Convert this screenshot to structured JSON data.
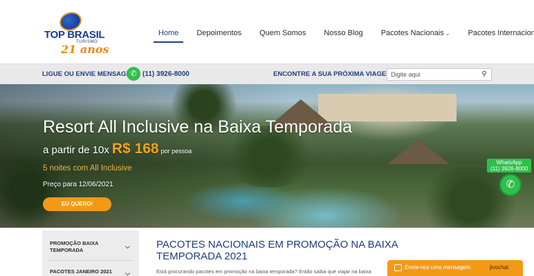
{
  "logo": {
    "brand": "TOP BRASIL",
    "sub": "TURISMO",
    "years": "21 anos"
  },
  "nav": {
    "items": [
      {
        "label": "Home"
      },
      {
        "label": "Depoimentos"
      },
      {
        "label": "Quem Somos"
      },
      {
        "label": "Nosso Blog"
      },
      {
        "label": "Pacotes Nacionais"
      },
      {
        "label": "Pacotes Internacionais"
      }
    ]
  },
  "contact_bar": {
    "label": "LIGUE OU ENVIE MENSAGEM:",
    "phone": "(11) 3926-8000",
    "find_label": "ENCONTRE A SUA PRÓXIMA VIAGEM:",
    "search_placeholder": "Digite aqui"
  },
  "hero": {
    "title": "Resort All Inclusive na Baixa Temporada",
    "price_prefix": "a partir de 10x",
    "price": "R$ 168",
    "price_suffix": "por pessoa",
    "nights": "5 noites com All Inclusive",
    "date": "Preço para 12/06/2021",
    "cta": "EU QUERO!"
  },
  "whatsapp_float": {
    "line1": "WhatsApp",
    "line2": "(11) 3926-8000"
  },
  "sidebar": {
    "items": [
      {
        "label": "PROMOÇÃO BAIXA TEMPORADA"
      },
      {
        "label": "PACOTES JANEIRO 2021"
      }
    ]
  },
  "main": {
    "title": "PACOTES NACIONAIS EM PROMOÇÃO NA BAIXA TEMPORADA 2021",
    "intro": "Está procurando pacotes em promoção na baixa temporada? Então saiba que viajar na baixa"
  },
  "chat": {
    "label": "Envie-nos uma mensagem",
    "brand": "jivochat"
  },
  "colors": {
    "brand_blue": "#1f3d7a",
    "accent_orange": "#f29a15",
    "whatsapp_green": "#2fbf4b"
  }
}
